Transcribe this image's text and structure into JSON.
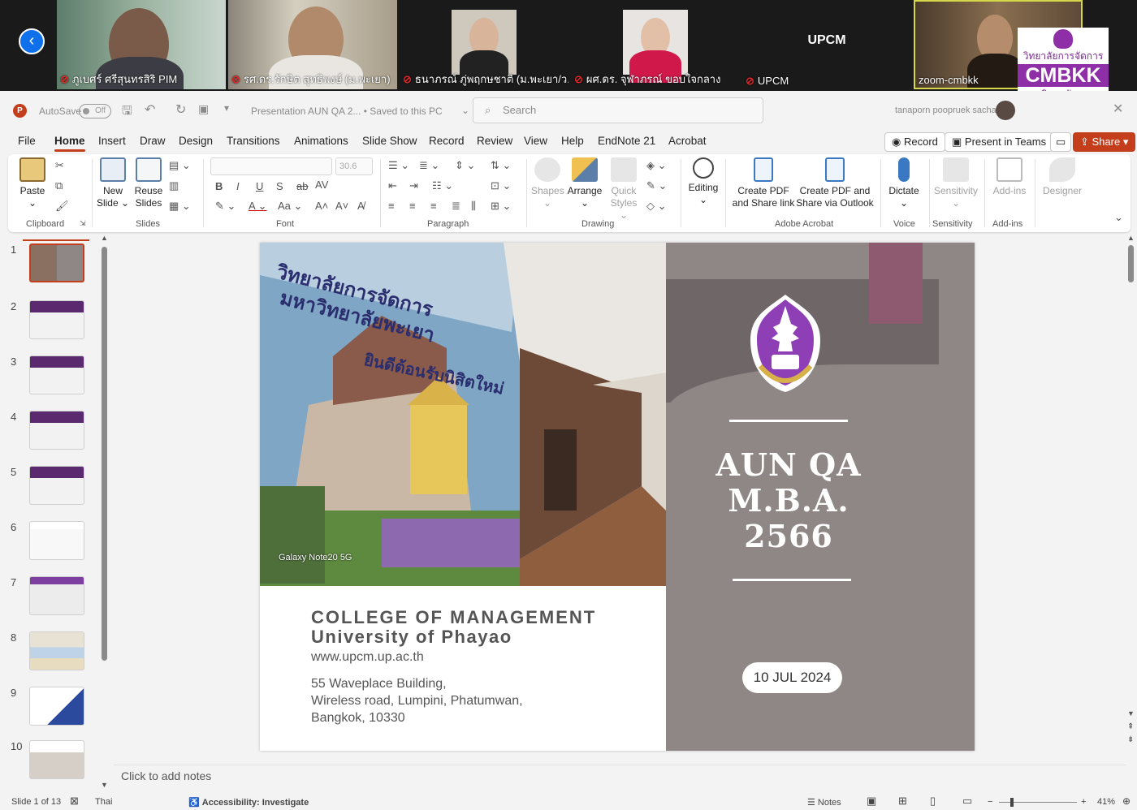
{
  "zoom": {
    "participants": [
      {
        "name": "ภูเบศร์ ศรีสุนทรสิริ PIM"
      },
      {
        "name": "รศ.ดร.รักษิต สุทธิพงษ์ (ม.พะเยา)"
      },
      {
        "name": "ธนาภรณ์ ภู่พฤกษชาติ (ม.พะเยา/ว...."
      },
      {
        "name": "ผศ.ดร. จุฬาภรณ์ ขอบใจกลาง"
      },
      {
        "name": "UPCM",
        "center_label": "UPCM"
      },
      {
        "name": "zoom-cmbkk"
      }
    ],
    "cmbkk_logo": {
      "line1": "วิทยาลัยการจัดการ",
      "line2": "CMBKK",
      "line3": "มหาวิทยาลัยพะเยา"
    }
  },
  "titlebar": {
    "autosave_label": "AutoSave",
    "autosave_state": "Off",
    "doc_title": "Presentation AUN QA 2... • Saved to this PC",
    "search_placeholder": "Search",
    "user_name": "tanaporn poopruek sachat"
  },
  "menu": {
    "tabs": [
      "File",
      "Home",
      "Insert",
      "Draw",
      "Design",
      "Transitions",
      "Animations",
      "Slide Show",
      "Record",
      "Review",
      "View",
      "Help",
      "EndNote 21",
      "Acrobat"
    ],
    "active_tab": "Home",
    "record_btn": "Record",
    "present_teams_btn": "Present in Teams",
    "share_btn": "Share"
  },
  "ribbon": {
    "paste": "Paste",
    "new_slide": "New Slide",
    "reuse_slides": "Reuse Slides",
    "font_size": "30.6",
    "shapes": "Shapes",
    "arrange": "Arrange",
    "quick_styles": "Quick Styles",
    "editing": "Editing",
    "create_pdf_share": "Create PDF and Share link",
    "create_pdf_outlook": "Create PDF and Share via Outlook",
    "dictate": "Dictate",
    "sensitivity": "Sensitivity",
    "addins": "Add-ins",
    "designer": "Designer",
    "groups": {
      "clipboard": "Clipboard",
      "slides": "Slides",
      "font": "Font",
      "paragraph": "Paragraph",
      "drawing": "Drawing",
      "adobe": "Adobe Acrobat",
      "voice": "Voice",
      "sensitivity": "Sensitivity",
      "addins": "Add-ins"
    }
  },
  "thumbnails": [
    "1",
    "2",
    "3",
    "4",
    "5",
    "6",
    "7",
    "8",
    "9",
    "10"
  ],
  "slide": {
    "title_line1": "AUN QA",
    "title_line2": "M.B.A.",
    "title_line3": "2566",
    "date": "10 JUL 2024",
    "college_line1": "COLLEGE OF MANAGEMENT",
    "college_line2": "University of Phayao",
    "website": "www.upcm.up.ac.th",
    "address_line1": "55 Waveplace Building,",
    "address_line2": "Wireless road, Lumpini, Phatumwan,",
    "address_line3": "Bangkok, 10330",
    "photo_watermark": "Galaxy Note20 5G",
    "photo_banner_thai1": "วิทยาลัยการจัดการ",
    "photo_banner_thai2": "มหาวิทยาลัยพะเยา",
    "photo_banner_thai3": "ยินดีต้อนรับนิสิตใหม่"
  },
  "notes_placeholder": "Click to add notes",
  "status": {
    "slide_info": "Slide 1 of 13",
    "language": "Thai",
    "accessibility": "Accessibility: Investigate",
    "notes": "Notes",
    "zoom": "41%"
  },
  "colors": {
    "accent": "#c43e1c",
    "slide_panel": "#8e8785",
    "purple": "#8e2fa7"
  }
}
